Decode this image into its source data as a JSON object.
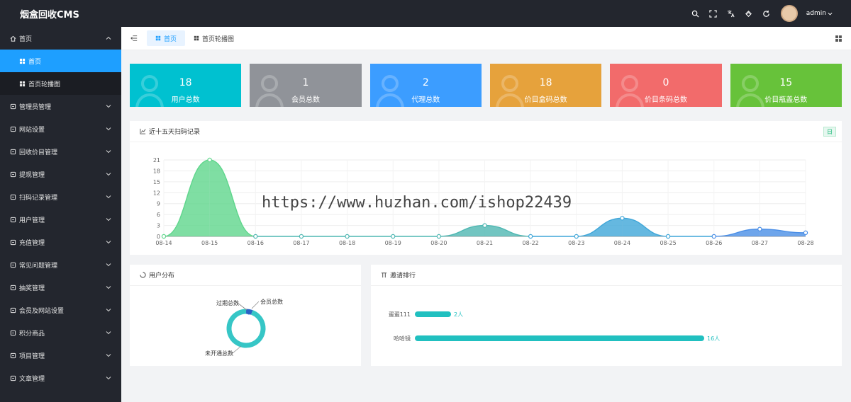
{
  "app": {
    "title": "烟盒回收CMS",
    "user": "admin"
  },
  "sidebar": {
    "items": [
      {
        "label": "首页",
        "icon": "home-icon",
        "expanded": true
      },
      {
        "label": "管理员管理",
        "icon": "user-icon"
      },
      {
        "label": "网站设置",
        "icon": "website-icon"
      },
      {
        "label": "回收价目管理",
        "icon": "leaf-icon"
      },
      {
        "label": "提现管理",
        "icon": "template-icon"
      },
      {
        "label": "扫码记录管理",
        "icon": "chart-icon"
      },
      {
        "label": "用户管理",
        "icon": "list-icon"
      },
      {
        "label": "充值管理",
        "icon": "app-icon"
      },
      {
        "label": "常见问题管理",
        "icon": "chart-icon"
      },
      {
        "label": "抽奖管理",
        "icon": "chart-icon"
      },
      {
        "label": "会员及网站设置",
        "icon": "set-icon"
      },
      {
        "label": "积分商品",
        "icon": "grid-icon"
      },
      {
        "label": "项目管理",
        "icon": "app-icon"
      },
      {
        "label": "文章管理",
        "icon": "app-icon"
      }
    ],
    "sub": [
      {
        "label": "首页",
        "active": true
      },
      {
        "label": "首页轮播图",
        "active": false
      }
    ]
  },
  "tabs": [
    {
      "label": "首页",
      "active": true
    },
    {
      "label": "首页轮播图",
      "active": false
    }
  ],
  "stats": [
    {
      "value": "18",
      "label": "用户总数",
      "color": "#00c1d0",
      "icon": "users-icon"
    },
    {
      "value": "1",
      "label": "会员总数",
      "color": "#909399",
      "icon": "document-icon"
    },
    {
      "value": "2",
      "label": "代理总数",
      "color": "#3c9dff",
      "icon": "dashboard-icon"
    },
    {
      "value": "18",
      "label": "价目盒码总数",
      "color": "#e6a23c",
      "icon": "user-icon"
    },
    {
      "value": "0",
      "label": "价目条码总数",
      "color": "#f26b6b",
      "icon": "alarm-icon"
    },
    {
      "value": "15",
      "label": "价目瓶盖总数",
      "color": "#67c23a",
      "icon": "user-check-icon"
    }
  ],
  "scan_panel": {
    "title": "近十五天扫码记录",
    "badge": "日"
  },
  "user_panel": {
    "title": "用户分布"
  },
  "invite_panel": {
    "title": "邀请排行"
  },
  "watermark": "https://www.huzhan.com/ishop22439",
  "chart_data": [
    {
      "type": "area",
      "title": "近十五天扫码记录",
      "categories": [
        "08-14",
        "08-15",
        "08-16",
        "08-17",
        "08-18",
        "08-19",
        "08-20",
        "08-21",
        "08-22",
        "08-23",
        "08-24",
        "08-25",
        "08-26",
        "08-27",
        "08-28"
      ],
      "values": [
        0,
        21,
        0,
        0,
        0,
        0,
        0,
        3,
        0,
        0,
        5,
        0,
        0,
        2,
        1
      ],
      "ylim": [
        0,
        21
      ],
      "yticks": [
        0,
        3,
        6,
        9,
        12,
        15,
        18,
        21
      ],
      "grid": true,
      "segment_colors": [
        "#5fd68c",
        "#5fd68c",
        "#4fb7b2",
        "#4fb7b2",
        "#4fb7b2",
        "#4fb7b2",
        "#4fb7b2",
        "#4fb7b2",
        "#3fa6d8",
        "#3fa6d8",
        "#3fa6d8",
        "#3fa6d8",
        "#4a8ee6",
        "#4a8ee6"
      ]
    },
    {
      "type": "pie",
      "title": "用户分布",
      "labels": [
        "过期总数",
        "会员总数",
        "未开通总数"
      ],
      "values": [
        0,
        1,
        17
      ],
      "colors": [
        "#3c9dff",
        "#2a63c5",
        "#36c6c6"
      ]
    },
    {
      "type": "bar",
      "title": "邀请排行",
      "categories": [
        "蛋蛋111",
        "哈哈镜"
      ],
      "values": [
        2,
        16
      ],
      "value_labels": [
        "2人",
        "16人"
      ],
      "color": "#21c0c0"
    }
  ]
}
